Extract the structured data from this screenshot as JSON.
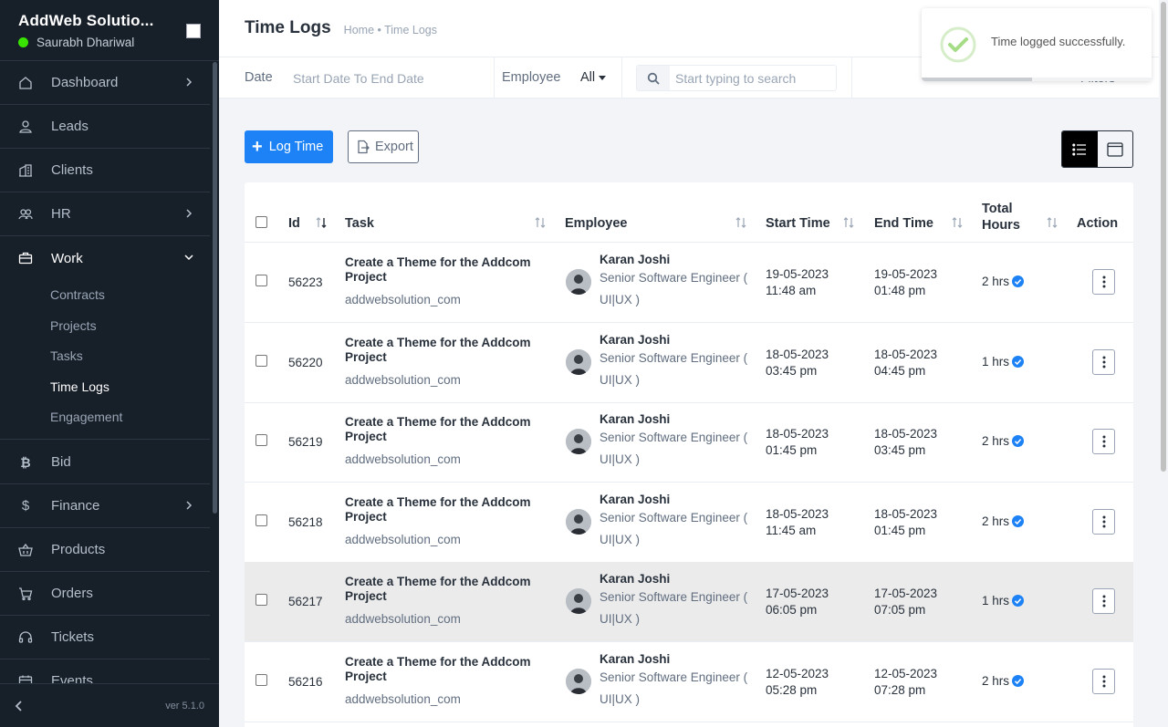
{
  "sidebar": {
    "company": "AddWeb Solutio...",
    "user": "Saurabh Dhariwal",
    "version": "ver 5.1.0",
    "menu": [
      {
        "label": "Dashboard",
        "icon": "home-icon"
      },
      {
        "label": "Leads",
        "icon": "user-icon"
      },
      {
        "label": "Clients",
        "icon": "building-icon"
      },
      {
        "label": "HR",
        "icon": "users-icon"
      },
      {
        "label": "Work",
        "icon": "briefcase-icon"
      },
      {
        "label": "Bid",
        "icon": "bitcoin-icon"
      },
      {
        "label": "Finance",
        "icon": "dollar-icon"
      },
      {
        "label": "Products",
        "icon": "basket-icon"
      },
      {
        "label": "Orders",
        "icon": "cart-icon"
      },
      {
        "label": "Tickets",
        "icon": "headset-icon"
      },
      {
        "label": "Events",
        "icon": "calendar-icon"
      }
    ],
    "work_submenu": [
      "Contracts",
      "Projects",
      "Tasks",
      "Time Logs",
      "Engagement"
    ]
  },
  "header": {
    "title": "Time Logs",
    "breadcrumb": "Home • Time Logs"
  },
  "filters": {
    "date_label": "Date",
    "date_placeholder": "Start Date To End Date",
    "employee_label": "Employee",
    "employee_value": "All",
    "search_placeholder": "Start typing to search",
    "filters_label": "Filters"
  },
  "toast": {
    "message": "Time logged successfully.",
    "progress": 0.48
  },
  "actions": {
    "log_time": "Log Time",
    "export": "Export"
  },
  "table": {
    "columns": [
      "Id",
      "Task",
      "Employee",
      "Start Time",
      "End Time",
      "Total",
      "Hours",
      "Action"
    ],
    "rows": [
      {
        "id": "56223",
        "task": "Create a Theme for the Addcom Project",
        "project": "addwebsolution_com",
        "employee": "Karan Joshi",
        "designation": "Senior Software Engineer (",
        "designation2": "UI|UX )",
        "start_date": "19-05-2023",
        "start_time": "11:48 am",
        "end_date": "19-05-2023",
        "end_time": "01:48 pm",
        "hours": "2 hrs"
      },
      {
        "id": "56220",
        "task": "Create a Theme for the Addcom Project",
        "project": "addwebsolution_com",
        "employee": "Karan Joshi",
        "designation": "Senior Software Engineer (",
        "designation2": "UI|UX )",
        "start_date": "18-05-2023",
        "start_time": "03:45 pm",
        "end_date": "18-05-2023",
        "end_time": "04:45 pm",
        "hours": "1 hrs"
      },
      {
        "id": "56219",
        "task": "Create a Theme for the Addcom Project",
        "project": "addwebsolution_com",
        "employee": "Karan Joshi",
        "designation": "Senior Software Engineer (",
        "designation2": "UI|UX )",
        "start_date": "18-05-2023",
        "start_time": "01:45 pm",
        "end_date": "18-05-2023",
        "end_time": "03:45 pm",
        "hours": "2 hrs"
      },
      {
        "id": "56218",
        "task": "Create a Theme for the Addcom Project",
        "project": "addwebsolution_com",
        "employee": "Karan Joshi",
        "designation": "Senior Software Engineer (",
        "designation2": "UI|UX )",
        "start_date": "18-05-2023",
        "start_time": "11:45 am",
        "end_date": "18-05-2023",
        "end_time": "01:45 pm",
        "hours": "2 hrs"
      },
      {
        "id": "56217",
        "task": "Create a Theme for the Addcom Project",
        "project": "addwebsolution_com",
        "employee": "Karan Joshi",
        "designation": "Senior Software Engineer (",
        "designation2": "UI|UX )",
        "start_date": "17-05-2023",
        "start_time": "06:05 pm",
        "end_date": "17-05-2023",
        "end_time": "07:05 pm",
        "hours": "1 hrs"
      },
      {
        "id": "56216",
        "task": "Create a Theme for the Addcom Project",
        "project": "addwebsolution_com",
        "employee": "Karan Joshi",
        "designation": "Senior Software Engineer (",
        "designation2": "UI|UX )",
        "start_date": "12-05-2023",
        "start_time": "05:28 pm",
        "end_date": "12-05-2023",
        "end_time": "07:28 pm",
        "hours": "2 hrs"
      }
    ]
  },
  "colors": {
    "sidebar_bg": "#171f29",
    "primary": "#1d82f5",
    "online": "#39e500",
    "toast_check": "#a5dc86"
  }
}
